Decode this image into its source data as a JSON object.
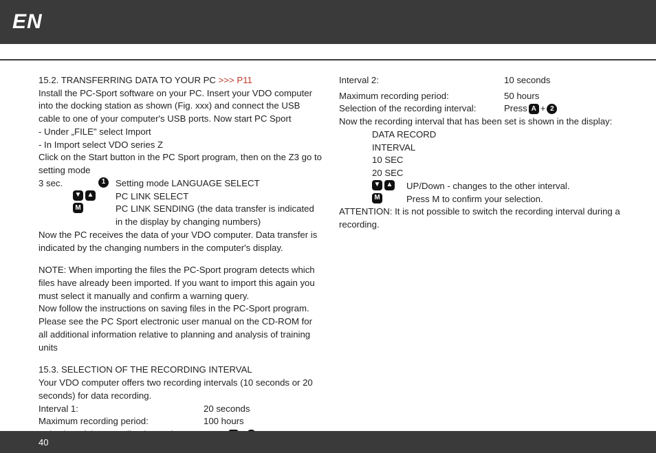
{
  "header": {
    "lang": "EN",
    "page_number": "40"
  },
  "left": {
    "s1": {
      "title_a": "15.2. TRANSFERRING DATA TO YOUR PC ",
      "title_b": ">>> P11",
      "p1": "Install the PC-Sport software on your PC. Insert your VDO computer into the docking station as shown (Fig. xxx) and connect the USB cable to one of your computer's USB ports. Now start PC Sport",
      "b1": "- Under „FILE\" select Import",
      "b2": "- In Import select VDO series Z",
      "p2": "Click on the Start button in the PC Sport program, then on the Z3 go to setting mode",
      "row1_left": "3 sec.",
      "row1_desc": "Setting mode LANGUAGE SELECT",
      "row2_desc": "PC LINK SELECT",
      "row3_desc": "PC LINK SENDING (the data transfer is indicated in the display by changing numbers)",
      "p3": "Now the PC receives the data of your VDO computer. Data transfer is indicated by the changing numbers in the computer's display.",
      "note": "NOTE: When importing the files the PC-Sport program detects which files have already been imported. If you want to import this again you must select it manually and confirm a warning query.",
      "p4": "Now follow the instructions on saving files in the PC-Sport program. Please see the PC Sport electronic user manual on the CD-ROM for all additional information relative to planning and analysis of training units"
    },
    "s2": {
      "title": "15.3. SELECTION OF THE RECORDING INTERVAL",
      "p1": "Your VDO computer offers two recording intervals (10 seconds or 20 seconds) for data recording.",
      "int1_l": "Interval 1:",
      "int1_r": "20 seconds",
      "max1_l": "Maximum recording period:",
      "max1_r": "100 hours",
      "sel_l": "Selection of the recording interval:",
      "sel_r_a": "Press ",
      "sel_r_plus": "+"
    }
  },
  "right": {
    "int2_l": "Interval 2:",
    "int2_r": "10 seconds",
    "max2_l": "Maximum recording period:",
    "max2_r": "50 hours",
    "sel_l": "Selection of the recording interval:",
    "sel_r_a": "Press ",
    "sel_r_plus": "+",
    "now": "Now the recording interval that has been set is shown in the display:",
    "d1": "DATA RECORD",
    "d2": "INTERVAL",
    "d3": "10 SEC",
    "d4": "20 SEC",
    "updown": "UP/Down - changes to the other interval.",
    "pressm": "Press M to confirm your selection.",
    "attn": "ATTENTION: It is not possible to switch the recording interval during a recording."
  },
  "icons": {
    "one": "1",
    "two": "2",
    "A": "A",
    "M": "M",
    "down": "▼",
    "up": "▲"
  }
}
